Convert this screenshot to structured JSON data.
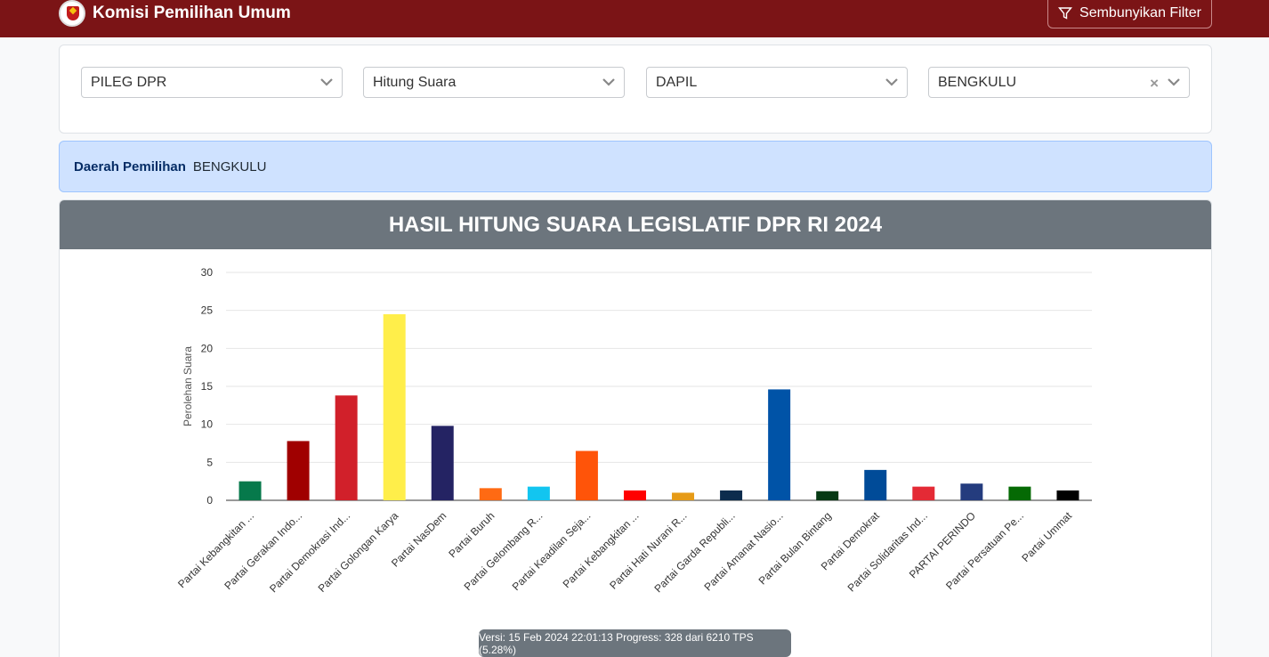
{
  "header": {
    "title": "Komisi Pemilihan Umum",
    "filter_button_label": "Sembunyikan Filter"
  },
  "filters": {
    "election_type": "PILEG DPR",
    "mode": "Hitung Suara",
    "level": "DAPIL",
    "region": "BENGKULU"
  },
  "info": {
    "label": "Daerah Pemilihan",
    "value": "BENGKULU"
  },
  "chart_title": "HASIL HITUNG SUARA LEGISLATIF DPR RI 2024",
  "chart_data": {
    "type": "bar",
    "ylabel": "Perolehan Suara",
    "ylim": [
      0,
      30
    ],
    "yticks": [
      "0",
      "5",
      "10",
      "15",
      "20",
      "25",
      "30"
    ],
    "grid": true,
    "categories": [
      "Partai Kebangkitan ...",
      "Partai Gerakan Indo...",
      "Partai Demokrasi Ind...",
      "Partai Golongan Karya",
      "Partai NasDem",
      "Partai Buruh",
      "Partai Gelombang R...",
      "Partai Keadilan Seja...",
      "Partai Kebangkitan ...",
      "Partai Hati Nurani R...",
      "Partai Garda Republi...",
      "Partai Amanat Nasio...",
      "Partai Bulan Bintang",
      "Partai Demokrat",
      "Partai Solidaritas Ind...",
      "PARTAI PERINDO",
      "Partai Persatuan Pe...",
      "Partai Ummat"
    ],
    "values": [
      2.5,
      7.8,
      13.8,
      24.5,
      9.8,
      1.6,
      1.8,
      6.5,
      1.3,
      1.0,
      1.3,
      14.6,
      1.2,
      4.0,
      1.8,
      2.2,
      1.8,
      1.3
    ],
    "colors": [
      "#06794b",
      "#a00000",
      "#d1202a",
      "#ffee4a",
      "#242363",
      "#ff6a13",
      "#12c5f0",
      "#ff5409",
      "#ff0000",
      "#e69b17",
      "#0c2c4d",
      "#0053a7",
      "#063a14",
      "#004b98",
      "#e42a35",
      "#243c7e",
      "#056a04",
      "#000000"
    ]
  },
  "status": {
    "version_text": "Versi: 15 Feb 2024 22:01:13 Progress: 328 dari 6210 TPS (5.28%)"
  }
}
